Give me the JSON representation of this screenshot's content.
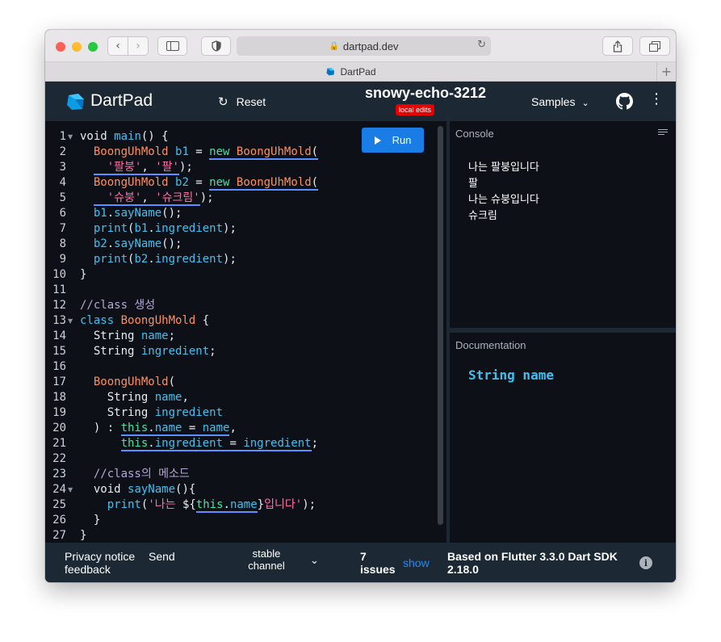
{
  "browser": {
    "url": "dartpad.dev",
    "tab_title": "DartPad"
  },
  "header": {
    "brand": "DartPad",
    "reset_label": "Reset",
    "project_name": "snowy-echo-3212",
    "badge": "local edits",
    "samples_label": "Samples"
  },
  "editor": {
    "run_label": "Run",
    "line_numbers": [
      "1",
      "2",
      "3",
      "4",
      "5",
      "6",
      "7",
      "8",
      "9",
      "10",
      "11",
      "12",
      "13",
      "14",
      "15",
      "16",
      "17",
      "18",
      "19",
      "20",
      "21",
      "22",
      "23",
      "24",
      "25",
      "26",
      "27"
    ]
  },
  "console": {
    "title": "Console",
    "output": [
      "나는 팔붕입니다",
      "팔",
      "나는 슈붕입니다",
      "슈크림"
    ]
  },
  "documentation": {
    "title": "Documentation",
    "signature": "String name"
  },
  "footer": {
    "privacy": "Privacy notice",
    "send": "Send",
    "feedback": "feedback",
    "channel_line1": "stable",
    "channel_line2": "channel",
    "issues_count": "7",
    "issues_label": "issues",
    "show": "show",
    "sdk_line1": "Based on Flutter 3.3.0 Dart SDK",
    "sdk_line2": "2.18.0"
  },
  "colors": {
    "header_bg": "#1c2834",
    "editor_bg": "#0d1117",
    "run_button": "#1a7de6",
    "badge": "#e60000",
    "keyword": "#3ec1f0",
    "class_name": "#ff8f5a",
    "string": "#ff6fa3"
  },
  "icons": [
    "lock-icon",
    "reload-icon",
    "dart-logo",
    "reset-icon",
    "chevron-down-icon",
    "github-icon",
    "more-vert-icon",
    "play-icon",
    "clear-console-icon",
    "info-icon"
  ]
}
